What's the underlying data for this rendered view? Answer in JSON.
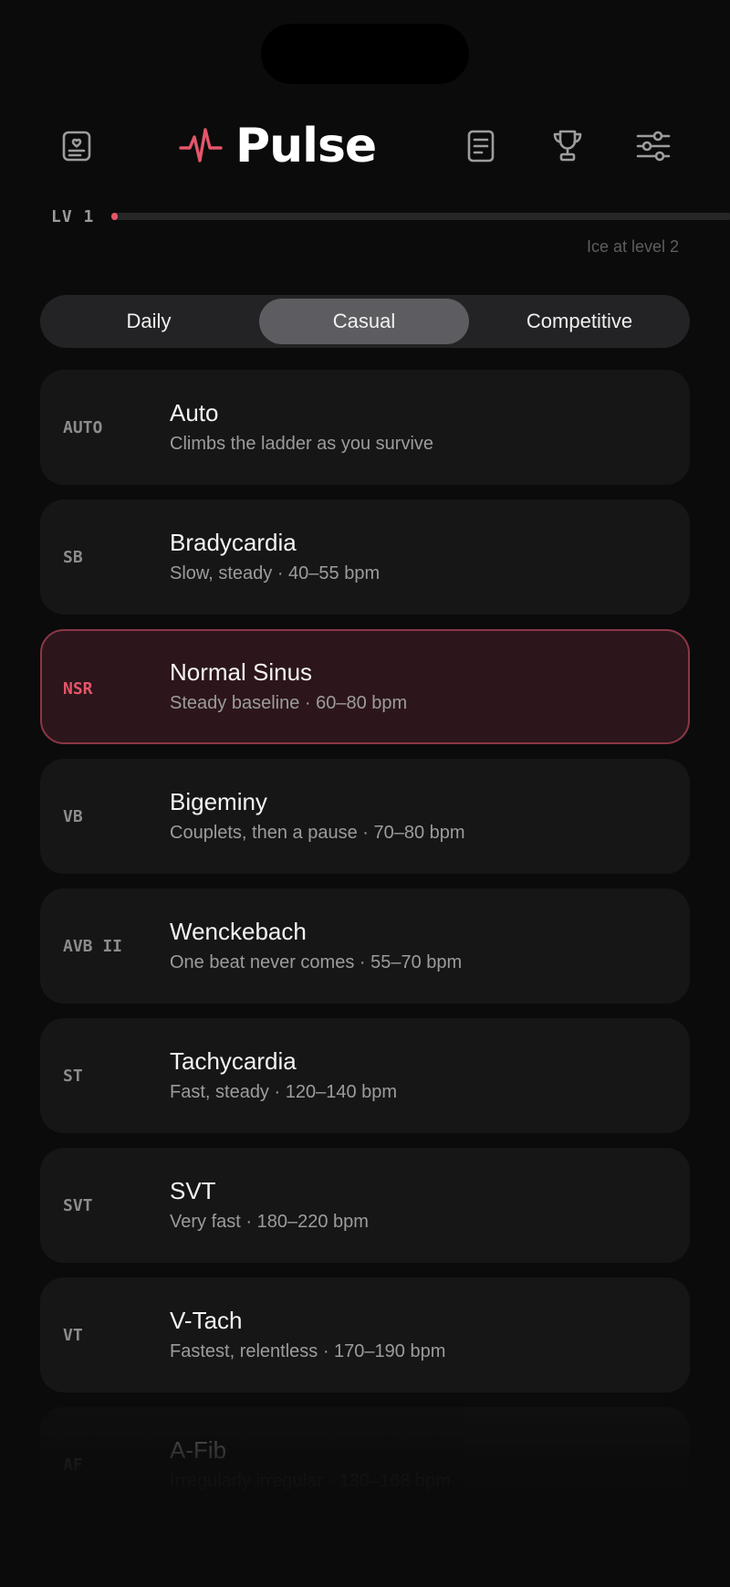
{
  "app": {
    "title": "Pulse",
    "accent_color": "#e4566a"
  },
  "header": {
    "icons": {
      "left": "profile-card-icon",
      "notes": "document-icon",
      "trophy": "trophy-icon",
      "settings": "sliders-icon",
      "logo": "heartbeat-icon"
    }
  },
  "level": {
    "label": "LV 1",
    "progress": 0.01,
    "next_unlock": "Ice at level 2"
  },
  "tabs": [
    {
      "label": "Daily",
      "active": false
    },
    {
      "label": "Casual",
      "active": true
    },
    {
      "label": "Competitive",
      "active": false
    }
  ],
  "rhythms": [
    {
      "code": "AUTO",
      "name": "Auto",
      "desc": "Climbs the ladder as you survive"
    },
    {
      "code": "SB",
      "name": "Bradycardia",
      "desc": "Slow, steady · 40–55 bpm"
    },
    {
      "code": "NSR",
      "name": "Normal Sinus",
      "desc": "Steady baseline · 60–80 bpm",
      "selected": true
    },
    {
      "code": "VB",
      "name": "Bigeminy",
      "desc": "Couplets, then a pause · 70–80 bpm"
    },
    {
      "code": "AVB II",
      "name": "Wenckebach",
      "desc": "One beat never comes · 55–70 bpm"
    },
    {
      "code": "ST",
      "name": "Tachycardia",
      "desc": "Fast, steady · 120–140 bpm"
    },
    {
      "code": "SVT",
      "name": "SVT",
      "desc": "Very fast · 180–220 bpm"
    },
    {
      "code": "VT",
      "name": "V-Tach",
      "desc": "Fastest, relentless · 170–190 bpm"
    },
    {
      "code": "AF",
      "name": "A-Fib",
      "desc": "Irregularly irregular · 130–168 bpm"
    }
  ]
}
